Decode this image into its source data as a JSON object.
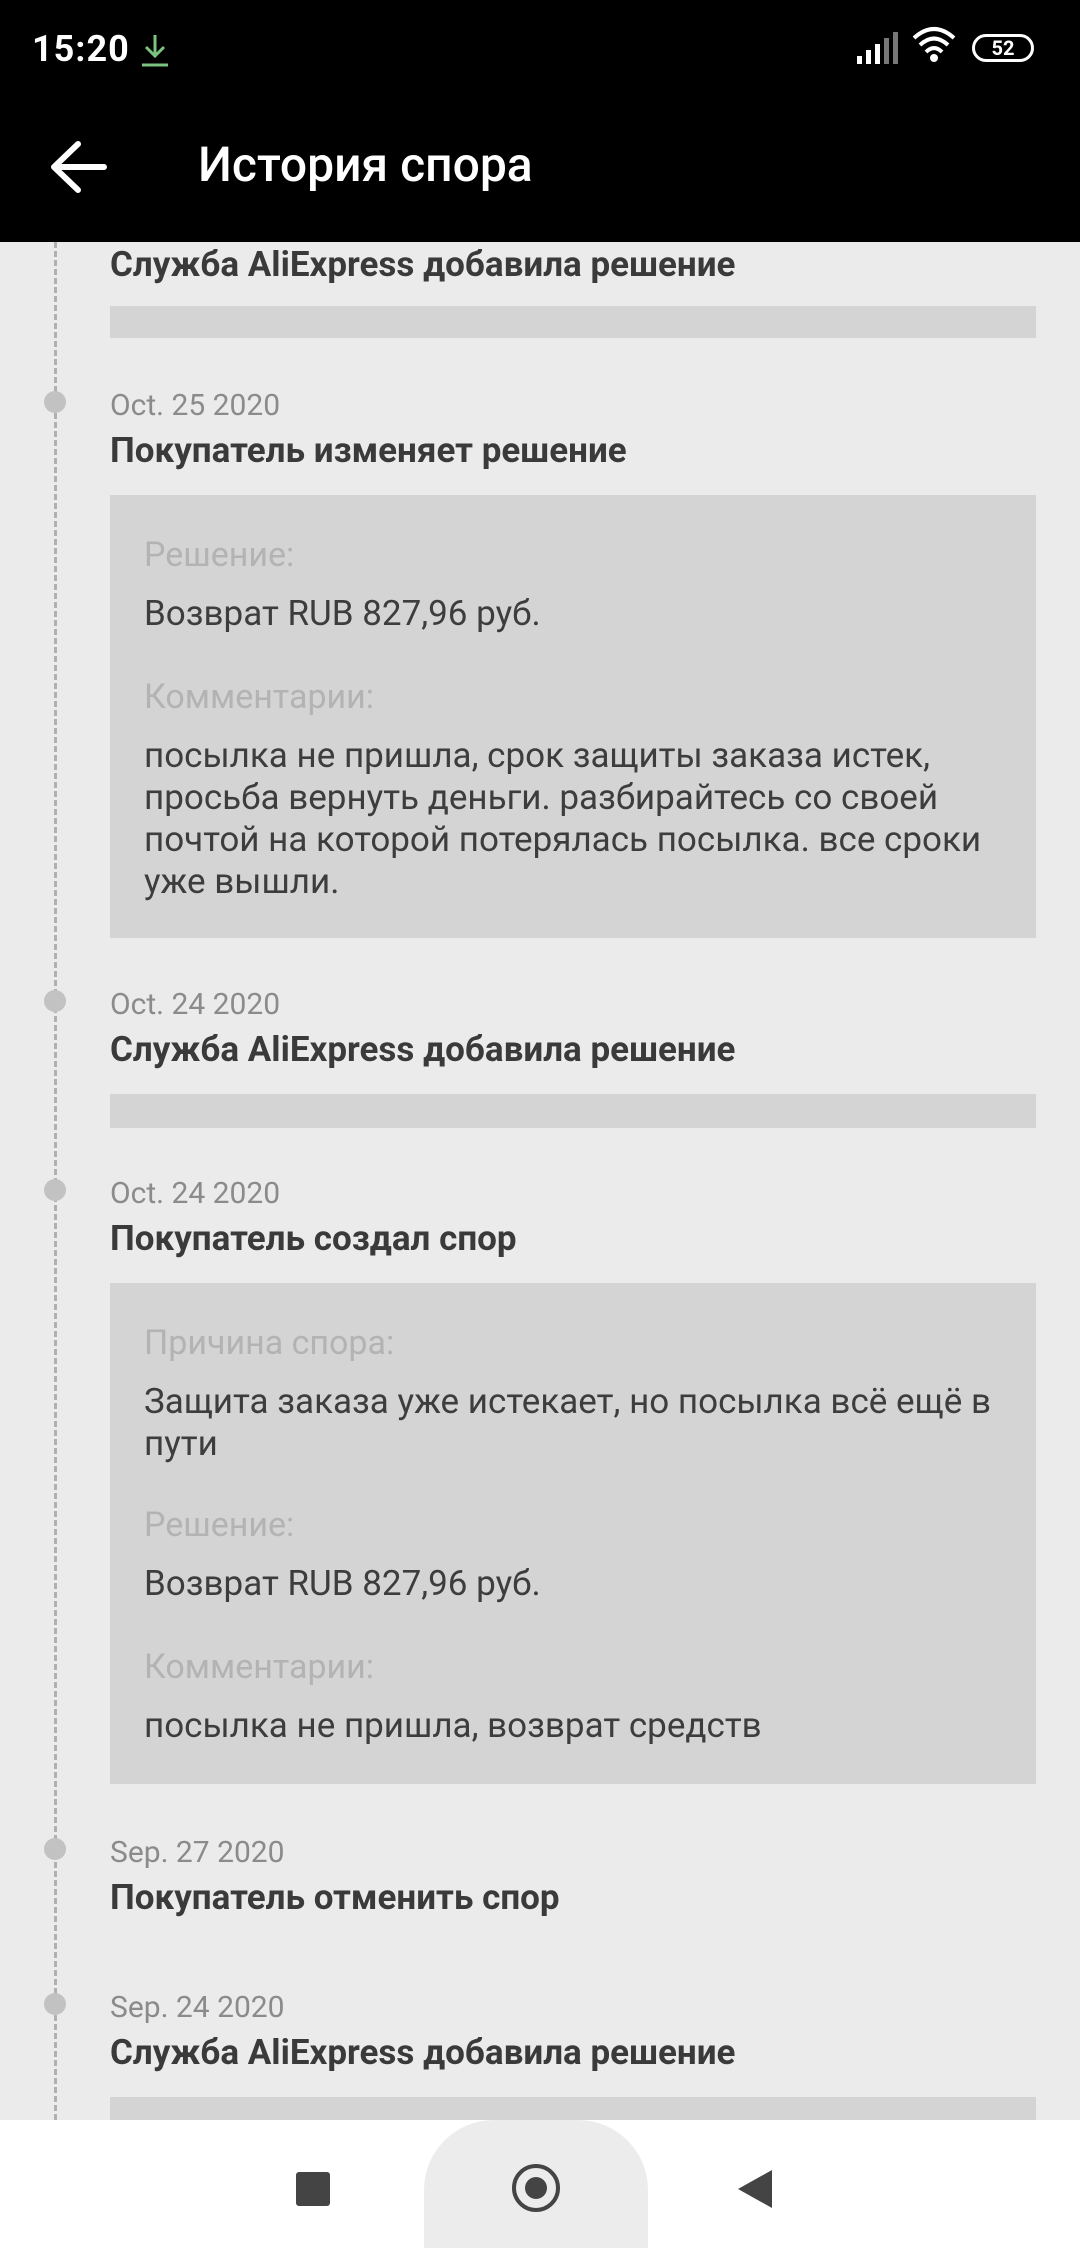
{
  "status_bar": {
    "time": "15:20",
    "battery": "52"
  },
  "app_bar": {
    "title": "История спора"
  },
  "events": [
    {
      "title": "Служба AliExpress добавила решение"
    },
    {
      "date": "Oct. 25 2020",
      "title": "Покупатель изменяет решение",
      "solution_label": "Решение:",
      "solution_value": "Возврат RUB 827,96 руб.",
      "comments_label": "Комментарии:",
      "comments_value": "посылка не пришла, срок защиты заказа истек, просьба вернуть деньги. разбирайтесь со своей почтой на которой потерялась посылка. все сроки уже вышли."
    },
    {
      "date": "Oct. 24 2020",
      "title": "Служба AliExpress добавила решение"
    },
    {
      "date": "Oct. 24 2020",
      "title": "Покупатель создал спор",
      "reason_label": "Причина спора:",
      "reason_value": "Защита заказа уже истекает, но посылка всё ещё в пути",
      "solution_label": "Решение:",
      "solution_value": "Возврат RUB 827,96 руб.",
      "comments_label": "Комментарии:",
      "comments_value": "посылка не пришла, возврат средств"
    },
    {
      "date": "Sep. 27 2020",
      "title": "Покупатель отменить спор"
    },
    {
      "date": "Sep. 24 2020",
      "title": "Служба AliExpress добавила решение"
    }
  ],
  "colors": {
    "card_bg": "#d4d4d4",
    "page_bg": "#ebebeb",
    "header_bg": "#000000"
  }
}
